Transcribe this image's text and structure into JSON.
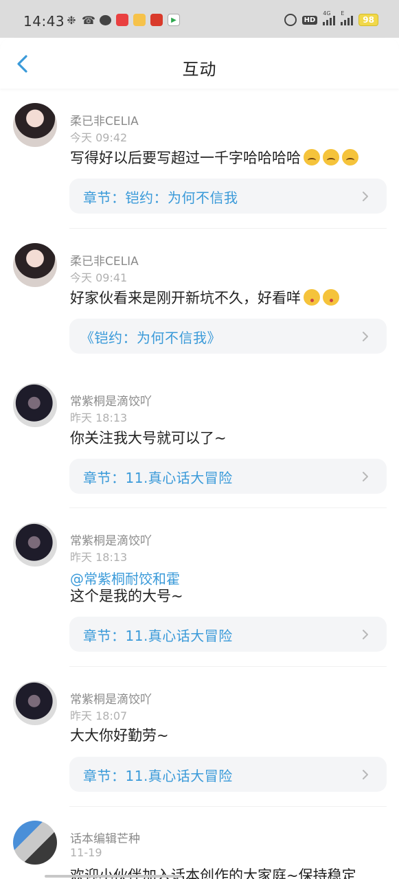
{
  "status_bar": {
    "time": "14:43",
    "network": "4G",
    "network2": "E",
    "hd": "HD",
    "battery": "98"
  },
  "header": {
    "title": "互动"
  },
  "items": [
    {
      "name": "柔已非CELIA",
      "time": "今天 09:42",
      "content": "写得好以后要写超过一千字哈哈哈哈",
      "card": "章节：铠约：为何不信我"
    },
    {
      "name": "柔已非CELIA",
      "time": "今天 09:41",
      "content": "好家伙看来是刚开新坑不久，好看咩",
      "card": "《铠约：为何不信我》"
    },
    {
      "name": "常紫桐是滴饺吖",
      "time": "昨天 18:13",
      "content": "你关注我大号就可以了~",
      "card": "章节：11.真心话大冒险"
    },
    {
      "name": "常紫桐是滴饺吖",
      "time": "昨天 18:13",
      "mention": "@常紫桐耐饺和霍",
      "content": "这个是我的大号~",
      "card": "章节：11.真心话大冒险"
    },
    {
      "name": "常紫桐是滴饺吖",
      "time": "昨天 18:07",
      "content": "大大你好勤劳~",
      "card": "章节：11.真心话大冒险"
    },
    {
      "name": "话本编辑芒种",
      "time": "11-19",
      "content": "欢迎小伙伴加入话本创作的大家庭~保持稳定"
    }
  ]
}
